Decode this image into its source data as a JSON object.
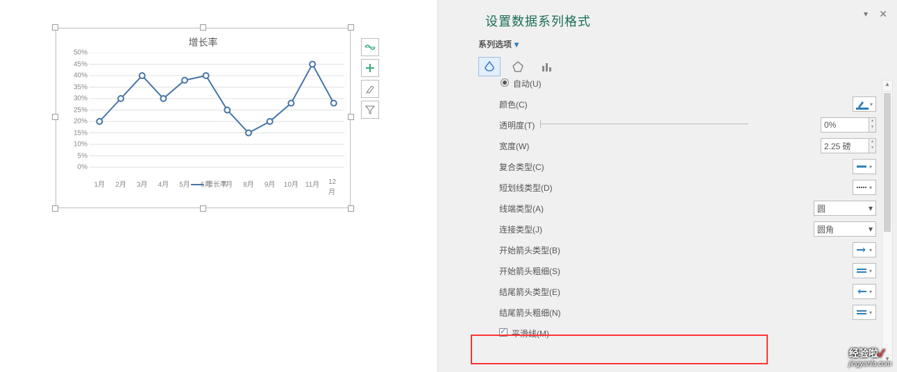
{
  "chart_data": {
    "type": "line",
    "title": "增长率",
    "series_name": "增长率",
    "categories": [
      "1月",
      "2月",
      "3月",
      "4月",
      "5月",
      "6月",
      "7月",
      "8月",
      "9月",
      "10月",
      "11月",
      "12月"
    ],
    "values": [
      20,
      30,
      40,
      30,
      38,
      40,
      25,
      15,
      20,
      28,
      45,
      28
    ],
    "ylabel": "",
    "ylim": [
      0,
      50
    ],
    "yticks": [
      "0%",
      "5%",
      "10%",
      "15%",
      "20%",
      "25%",
      "30%",
      "35%",
      "40%",
      "45%",
      "50%"
    ]
  },
  "panel": {
    "title": "设置数据系列格式",
    "series_options": "系列选项",
    "auto": "自动(U)",
    "color": "颜色(C)",
    "transparency": "透明度(T)",
    "transparency_val": "0%",
    "width": "宽度(W)",
    "width_val": "2.25 磅",
    "compound": "复合类型(C)",
    "dash": "短划线类型(D)",
    "cap": "线端类型(A)",
    "cap_val": "圆",
    "join": "连接类型(J)",
    "join_val": "圆角",
    "begin_arrow_type": "开始箭头类型(B)",
    "begin_arrow_size": "开始箭头粗细(S)",
    "end_arrow_type": "结尾箭头类型(E)",
    "end_arrow_size": "结尾箭头粗细(N)",
    "smooth": "平滑线(M)"
  },
  "watermark": {
    "brand": "经验啦",
    "url": "jingyanla.com"
  }
}
